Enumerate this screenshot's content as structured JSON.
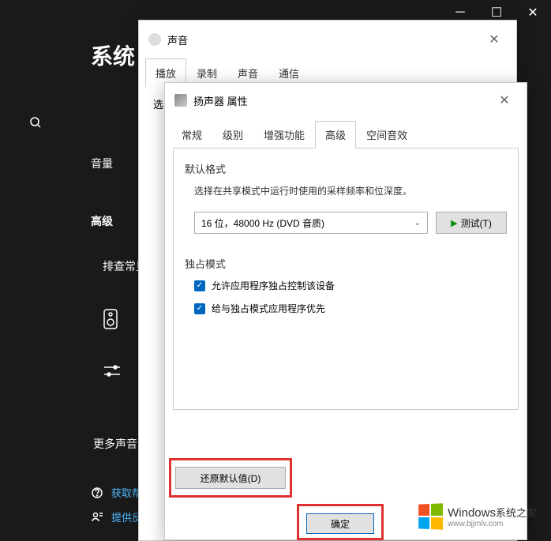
{
  "settings": {
    "title": "系统",
    "sidebar": {
      "volume": "音量",
      "advanced": "高级",
      "troubleshoot": "排查常见",
      "more": "更多声音"
    },
    "help": {
      "get_help": "获取帮助",
      "feedback": "提供反馈"
    }
  },
  "sound_dialog": {
    "title": "声音",
    "tabs": {
      "playback": "播放",
      "record": "录制",
      "sound": "声音",
      "comm": "通信"
    },
    "select_label": "选"
  },
  "speaker_dialog": {
    "title": "扬声器 属性",
    "tabs": {
      "general": "常规",
      "levels": "级别",
      "enhance": "增强功能",
      "advanced": "高级",
      "spatial": "空间音效"
    },
    "default_format": {
      "title": "默认格式",
      "desc": "选择在共享模式中运行时使用的采样频率和位深度。",
      "value": "16 位，48000 Hz (DVD 音质)",
      "test": "测试(T)"
    },
    "exclusive": {
      "title": "独占模式",
      "opt1": "允许应用程序独占控制该设备",
      "opt2": "给与独占模式应用程序优先"
    },
    "restore": "还原默认值(D)",
    "ok": "确定"
  },
  "watermark": {
    "brand": "Windows",
    "suffix": "系统之家",
    "url": "www.bjjmlv.com"
  }
}
